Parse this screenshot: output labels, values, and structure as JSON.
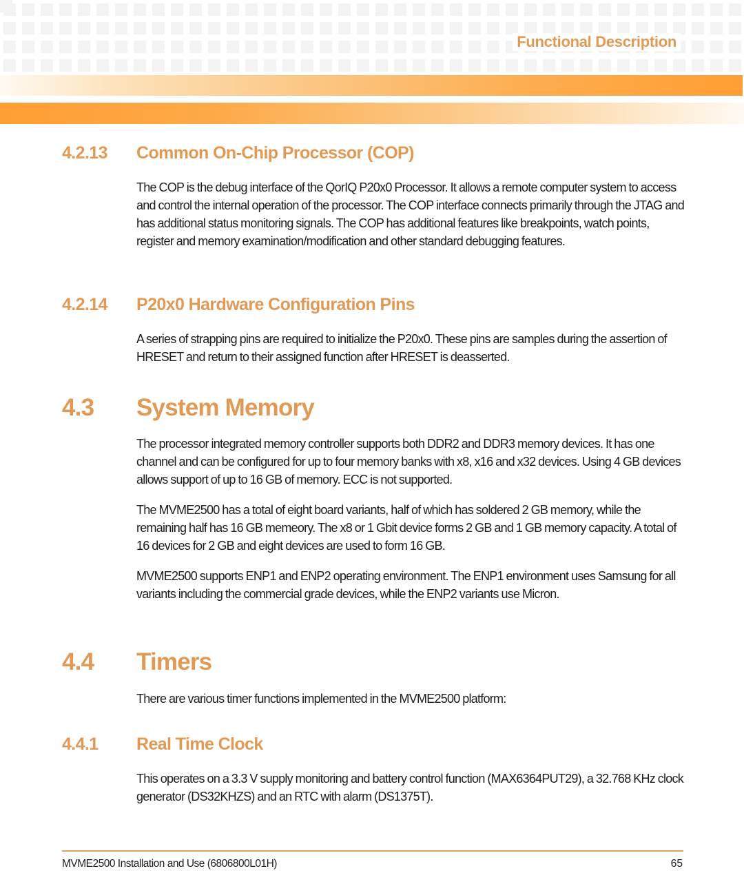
{
  "header": {
    "section_label": "Functional Description"
  },
  "sections": [
    {
      "number": "4.2.13",
      "title": "Common On-Chip Processor (COP)",
      "paragraphs": [
        "The COP is the debug interface of the QorIQ P20x0 Processor. It allows a remote computer system to access and control the internal operation of the processor. The COP interface connects primarily through the JTAG and has additional status monitoring signals. The COP has additional features like breakpoints, watch points, register and memory examination/modification and other standard debugging features."
      ]
    },
    {
      "number": "4.2.14",
      "title": "P20x0 Hardware Configuration Pins",
      "paragraphs": [
        "A series of strapping pins are required to initialize the P20x0. These pins are samples during the assertion of HRESET and return to their assigned function after HRESET is deasserted."
      ]
    },
    {
      "number": "4.3",
      "title": "System Memory",
      "paragraphs": [
        "The processor integrated memory controller supports both DDR2 and DDR3 memory devices. It has one channel and can be configured for up to four memory banks with x8, x16 and x32 devices. Using 4 GB devices allows support of up to 16 GB of memory. ECC is not supported.",
        "The MVME2500 has a total of eight board variants, half of which has soldered 2 GB memory, while the remaining half has 16 GB memeory. The x8 or 1 Gbit device forms 2 GB and 1 GB memory capacity. A total of 16 devices for 2 GB and eight devices are used to form 16 GB.",
        "MVME2500 supports ENP1 and ENP2 operating environment. The ENP1 environment uses Samsung  for all variants including the commercial grade devices, while the ENP2 variants use Micron."
      ]
    },
    {
      "number": "4.4",
      "title": "Timers",
      "paragraphs": [
        "There are various timer functions implemented in the MVME2500 platform:"
      ]
    },
    {
      "number": "4.4.1",
      "title": "Real Time Clock",
      "paragraphs": [
        "This operates on a 3.3 V supply monitoring and battery control function (MAX6364PUT29), a 32.768 KHz clock generator (DS32KHZS) and an RTC with alarm (DS1375T)."
      ]
    }
  ],
  "footer": {
    "document_title": "MVME2500 Installation and Use (6806800L01H)",
    "page_number": "65"
  },
  "colors": {
    "heading": "#e19a55",
    "accent_orange": "#ff9e33",
    "footer_rule": "#d9a566",
    "body_text": "#1c1c1c"
  }
}
